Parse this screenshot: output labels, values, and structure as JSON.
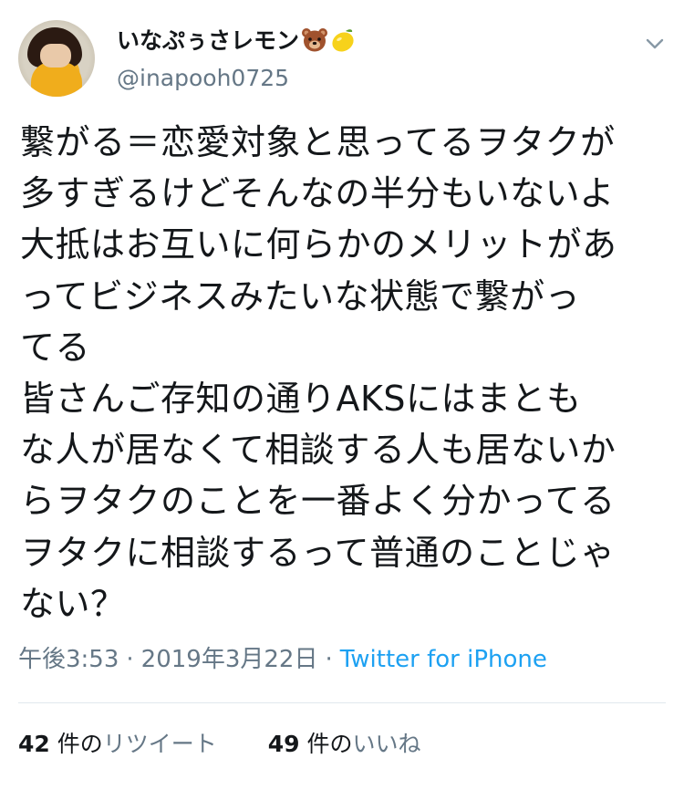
{
  "user": {
    "display_name": "いなぷぅさレモン",
    "handle": "@inapooh0725",
    "emojis": [
      "bear-face-emoji",
      "lemon-emoji"
    ]
  },
  "tweet": {
    "lines": [
      "繋がる＝恋愛対象と思ってるヲタクが",
      "多すぎるけどそんなの半分もいないよ",
      "大抵はお互いに何らかのメリットがあ",
      "ってビジネスみたいな状態で繋がっ",
      "てる",
      "皆さんご存知の通りAKSにはまとも",
      "な人が居なくて相談する人も居ないか",
      "らヲタクのことを一番よく分かってる",
      "ヲタクに相談するって普通のことじゃ",
      "ない？"
    ],
    "time": "午後3:53",
    "separator": "·",
    "date": "2019年3月22日",
    "source": "Twitter for iPhone"
  },
  "stats": {
    "retweets": {
      "count": "42",
      "unit": "件の",
      "label": "リツイート"
    },
    "likes": {
      "count": "49",
      "unit": "件の",
      "label": "いいね"
    }
  },
  "colors": {
    "text": "#14171a",
    "secondary": "#657786",
    "link": "#1da1f2",
    "divider": "#e1e8ed"
  },
  "icons": {
    "menu": "chevron-down-icon"
  }
}
